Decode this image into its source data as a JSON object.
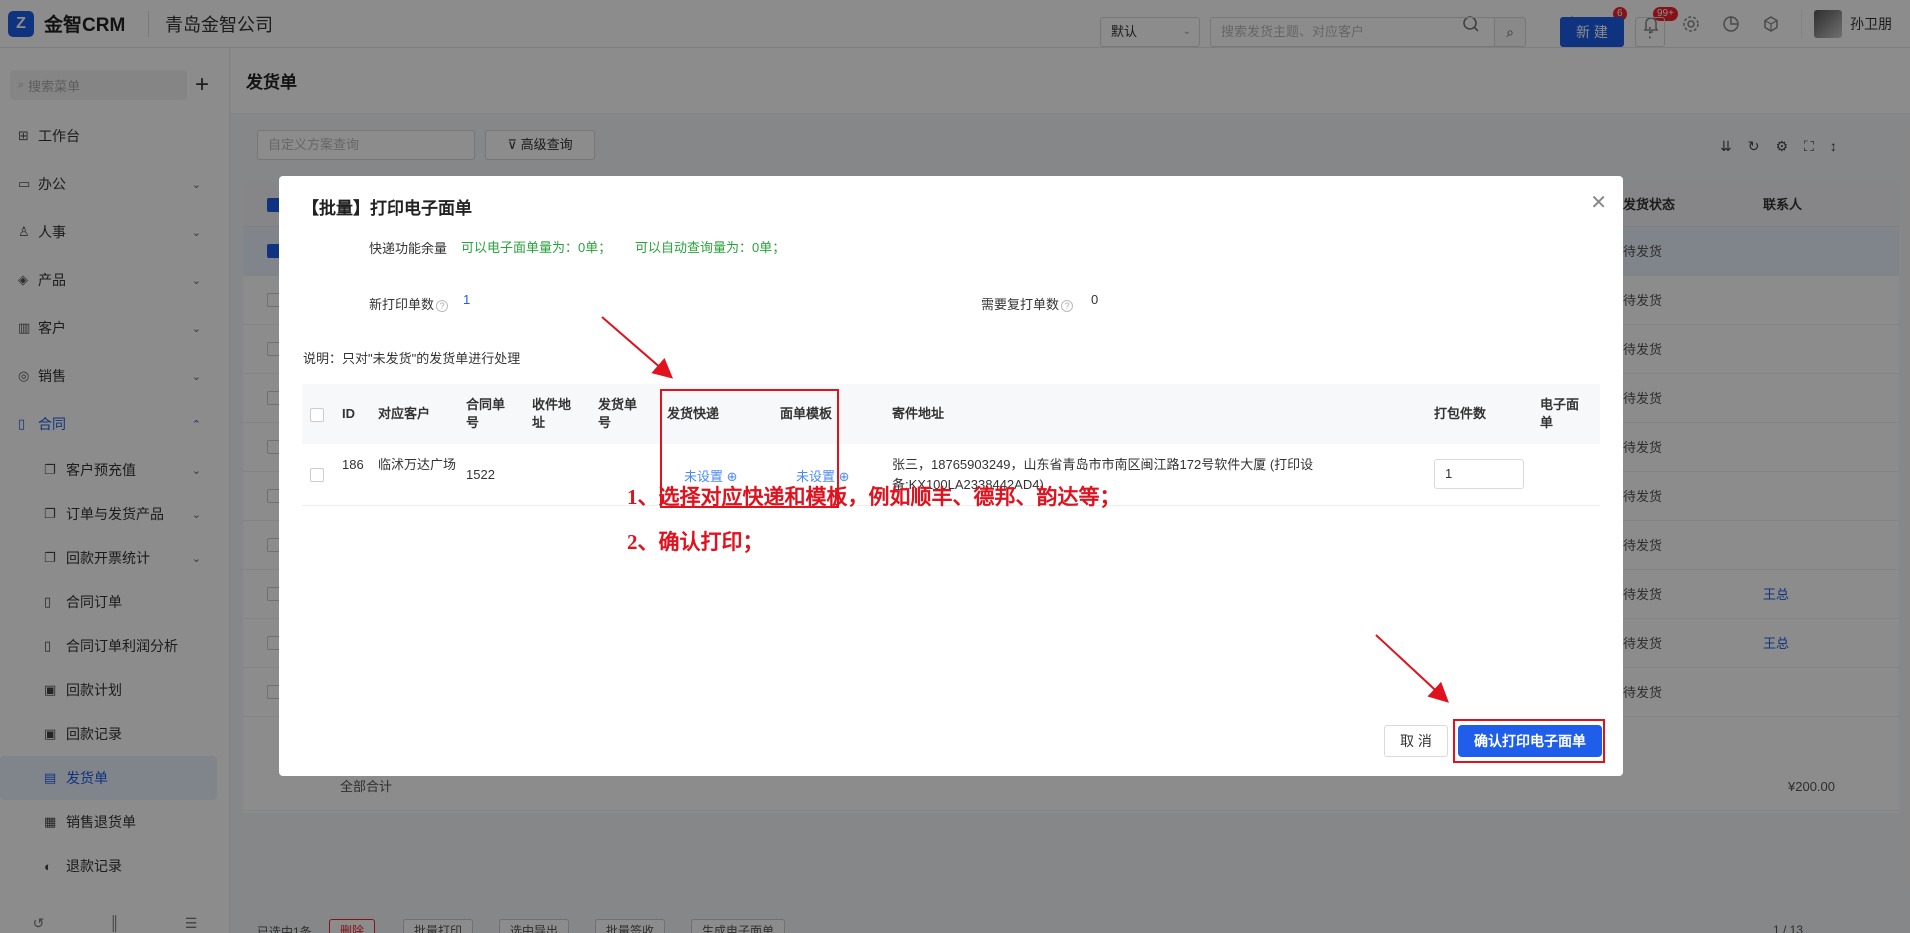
{
  "app": {
    "logo_mark": "Z",
    "name": "金智CRM",
    "company": "青岛金智公司"
  },
  "header": {
    "icons": [
      "search-icon",
      "speaker-icon",
      "inbox-icon",
      "bell-icon",
      "gear-icon",
      "chart-icon",
      "cube-icon"
    ],
    "inbox_badge": "6",
    "bell_badge": "99+",
    "user_name": "孙卫朋"
  },
  "sidebar": {
    "search_placeholder": "搜索菜单",
    "add_symbol": "+",
    "items": [
      {
        "label": "工作台",
        "icon": "⊞"
      },
      {
        "label": "办公",
        "icon": "▭"
      },
      {
        "label": "人事",
        "icon": "♙"
      },
      {
        "label": "产品",
        "icon": "◈"
      },
      {
        "label": "客户",
        "icon": "▥"
      },
      {
        "label": "销售",
        "icon": "◎"
      },
      {
        "label": "合同",
        "icon": "▯"
      }
    ],
    "sub_items": [
      {
        "label": "客户预充值",
        "icon": "❐"
      },
      {
        "label": "订单与发货产品",
        "icon": "❐"
      },
      {
        "label": "回款开票统计",
        "icon": "❐"
      },
      {
        "label": "合同订单",
        "icon": "▯"
      },
      {
        "label": "合同订单利润分析",
        "icon": "▯"
      },
      {
        "label": "回款计划",
        "icon": "▣"
      },
      {
        "label": "回款记录",
        "icon": "▣"
      },
      {
        "label": "发货单",
        "icon": "▤"
      },
      {
        "label": "销售退货单",
        "icon": "▦"
      },
      {
        "label": "退款记录",
        "icon": "◐"
      }
    ]
  },
  "main": {
    "title": "发货单",
    "view_select": "默认",
    "search_placeholder": "搜索发货主题、对应客户",
    "new_label": "新 建",
    "more_symbol": "⋮",
    "scheme_placeholder": "自定义方案查询",
    "advanced_label": "高级查询",
    "col_status": "发货状态",
    "col_contact": "联系人",
    "status_value": "待发货",
    "contact_value": "王总",
    "total_label": "全部合计",
    "total_amount": "¥200.00",
    "selected_text": "已选中1条",
    "bottom_buttons": [
      "删除",
      "批量打印",
      "选中导出",
      "批量签收",
      "生成电子面单"
    ],
    "pagination": "1 / 13"
  },
  "modal": {
    "title": "【批量】打印电子面单",
    "close_symbol": "✕",
    "quota_label": "快递功能余量",
    "quota_eorder": "可以电子面单量为：0单；",
    "quota_query": "可以自动查询量为：0单；",
    "new_print_label": "新打印单数",
    "new_print_value": "1",
    "reprint_label": "需要复打单数",
    "reprint_value": "0",
    "note": "说明：只对\"未发货\"的发货单进行处理",
    "table": {
      "headers": {
        "id": "ID",
        "customer": "对应客户",
        "contract_no": "合同单号",
        "recv_addr": "收件地址",
        "ship_no": "发货单号",
        "express": "发货快递",
        "template": "面单模板",
        "sender_addr": "寄件地址",
        "packages": "打包件数",
        "eorder": "电子面单"
      },
      "row": {
        "id": "186",
        "customer": "临沭万达广场",
        "contract_no": "1522",
        "express": "未设置",
        "template": "未设置",
        "sender_addr": "张三，18765903249，山东省青岛市市南区闽江路172号软件大厦 (打印设备:KX100LA2338442AD4)",
        "packages": "1"
      }
    },
    "instructions": [
      "1、选择对应快递和模板，例如顺丰、德邦、韵达等；",
      "2、确认打印；"
    ],
    "cancel_label": "取 消",
    "confirm_label": "确认打印电子面单"
  },
  "colors": {
    "primary": "#1e5eea",
    "annotation_red": "#e0121e",
    "quota_green": "#2aa33a"
  }
}
